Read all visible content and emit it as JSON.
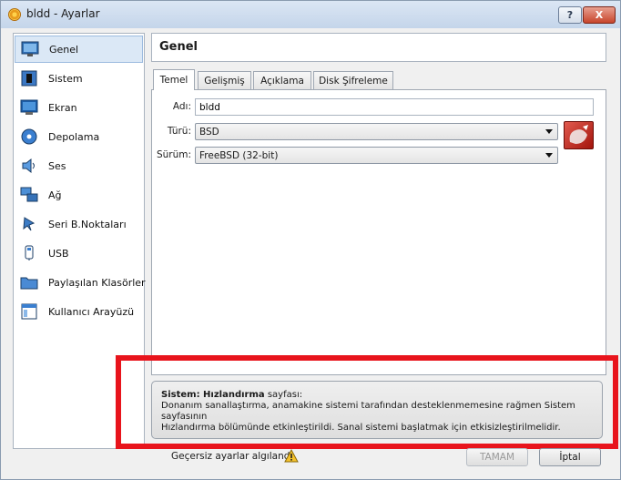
{
  "window": {
    "title": "bldd - Ayarlar",
    "help_label": "?",
    "close_label": "X"
  },
  "sidebar": {
    "items": [
      {
        "label": "Genel",
        "icon": "monitor-icon"
      },
      {
        "label": "Sistem",
        "icon": "chip-icon"
      },
      {
        "label": "Ekran",
        "icon": "display-icon"
      },
      {
        "label": "Depolama",
        "icon": "disk-icon"
      },
      {
        "label": "Ses",
        "icon": "speaker-icon"
      },
      {
        "label": "Ağ",
        "icon": "network-icon"
      },
      {
        "label": "Seri B.Noktaları",
        "icon": "serial-port-icon"
      },
      {
        "label": "USB",
        "icon": "usb-icon"
      },
      {
        "label": "Paylaşılan Klasörler",
        "icon": "folder-icon"
      },
      {
        "label": "Kullanıcı Arayüzü",
        "icon": "user-interface-icon"
      }
    ],
    "selected": "Genel"
  },
  "page": {
    "title": "Genel",
    "tabs": [
      "Temel",
      "Gelişmiş",
      "Açıklama",
      "Disk Şifreleme"
    ],
    "active_tab": "Temel",
    "fields": {
      "name_label": "Adı:",
      "name_value": "bldd",
      "type_label": "Türü:",
      "type_value": "BSD",
      "version_label": "Sürüm:",
      "version_value": "FreeBSD (32-bit)"
    }
  },
  "warning": {
    "title_bold": "Sistem: Hızlandırma",
    "title_rest": " sayfası:",
    "line1": "Donanım sanallaştırma, anamakine sistemi tarafından desteklenmemesine rağmen Sistem sayfasının",
    "line2": "Hızlandırma bölümünde etkinleştirildi. Sanal sistemi başlatmak için etkisizleştirilmelidir."
  },
  "footer": {
    "invalid_text": "Geçersiz ayarlar algılandı",
    "ok_label": "TAMAM",
    "cancel_label": "İptal"
  },
  "colors": {
    "highlight_frame": "#e8141c",
    "selection": "#dbe8f6"
  }
}
